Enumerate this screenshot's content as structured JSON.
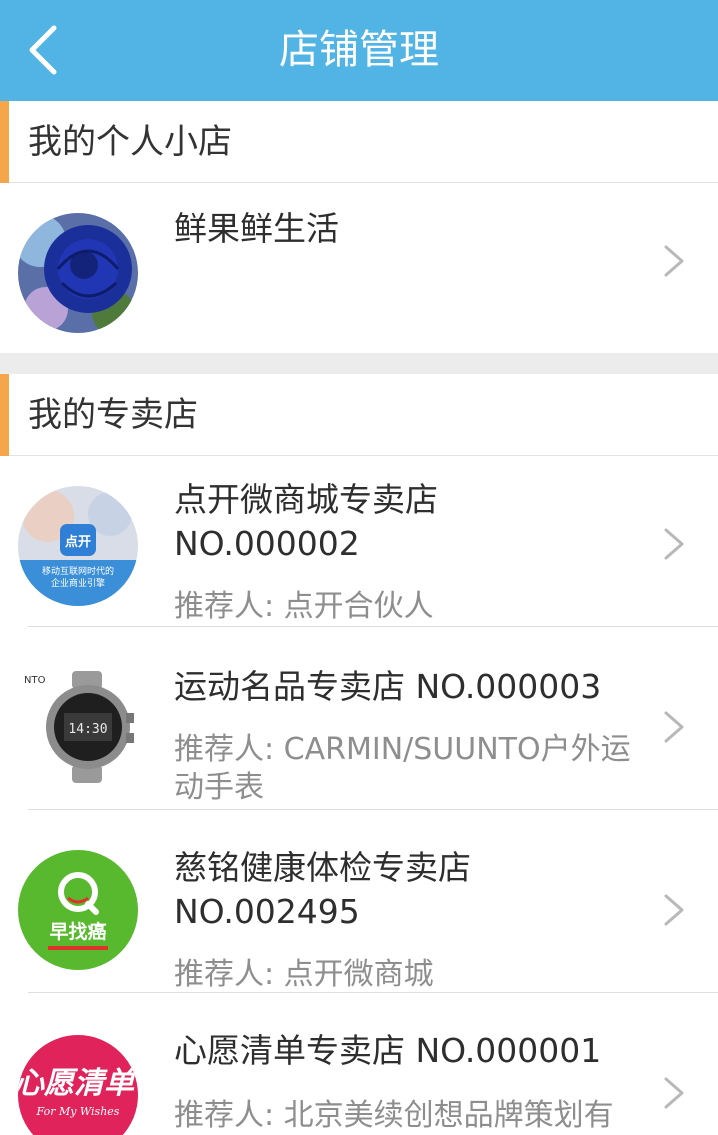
{
  "header": {
    "title": "店铺管理"
  },
  "sections": {
    "personal": {
      "title": "我的个人小店",
      "shop": {
        "name": "鲜果鲜生活"
      }
    },
    "specialty": {
      "title": "我的专卖店",
      "stores": [
        {
          "name": "点开微商城专卖店 NO.000002",
          "referrer": "推荐人: 点开合伙人",
          "logo_text_1": "点开",
          "logo_text_2": "移动互联网时代的",
          "logo_text_3": "企业商业引擎"
        },
        {
          "name": "运动名品专卖店 NO.000003",
          "referrer": "推荐人: CARMIN/SUUNTO户外运动手表",
          "logo_text_1": "NTO",
          "logo_text_2": "14:30"
        },
        {
          "name": "慈铭健康体检专卖店 NO.002495",
          "referrer": "推荐人: 点开微商城",
          "logo_text_1": "早找癌"
        },
        {
          "name": "心愿清单专卖店 NO.000001",
          "referrer": "推荐人: 北京美续创想品牌策划有",
          "logo_text_1": "心愿清单",
          "logo_text_2": "For My Wishes"
        }
      ]
    }
  },
  "colors": {
    "topbar": "#52b4e4",
    "accent": "#f5a54a",
    "gap": "#ececec"
  }
}
